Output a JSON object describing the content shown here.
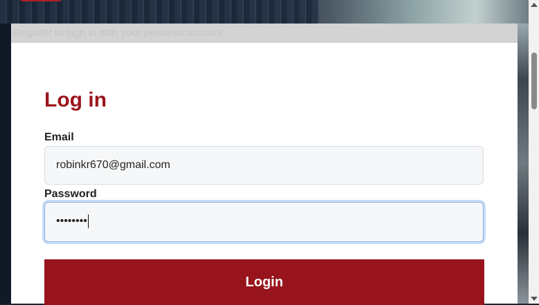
{
  "top_banner": {
    "text": "Register to sign in with your personal account"
  },
  "login": {
    "title": "Log in",
    "email_label": "Email",
    "email_value": "robinkr670@gmail.com",
    "password_label": "Password",
    "password_value": "••••••••",
    "submit_label": "Login"
  },
  "colors": {
    "accent": "#97141c",
    "title": "#9b151d",
    "focus_ring": "#8db4e8"
  },
  "icons": {
    "scroll_up": "triangle-up",
    "scroll_down": "triangle-down"
  }
}
